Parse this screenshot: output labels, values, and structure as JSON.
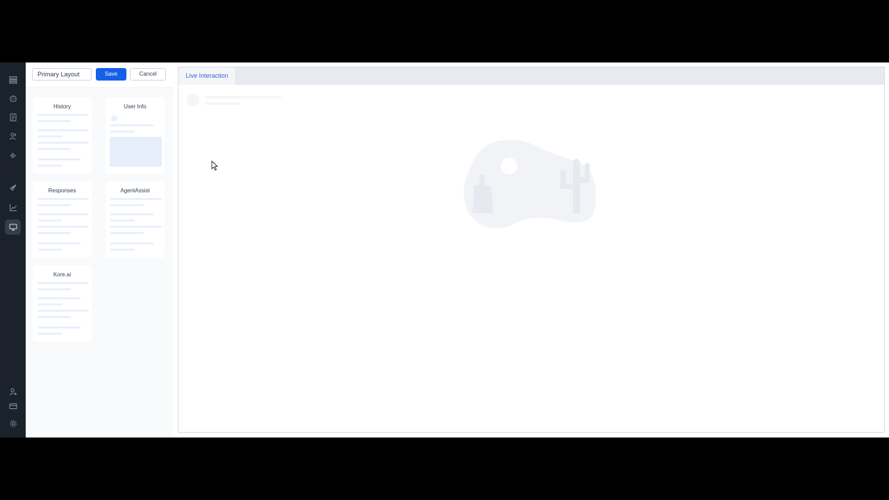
{
  "nav_rail": {
    "items": [
      {
        "icon": "layers-icon",
        "name": "nav-layers"
      },
      {
        "icon": "bot-icon",
        "name": "nav-bot"
      },
      {
        "icon": "document-icon",
        "name": "nav-documents"
      },
      {
        "icon": "users-icon",
        "name": "nav-agents"
      },
      {
        "icon": "voice-icon",
        "name": "nav-voice"
      },
      {
        "icon": "rocket-icon",
        "name": "nav-deploy"
      },
      {
        "icon": "analytics-icon",
        "name": "nav-analytics"
      },
      {
        "icon": "monitor-icon",
        "name": "nav-agent-desktop",
        "active": true
      },
      {
        "icon": "user-add-icon",
        "name": "nav-user-management"
      },
      {
        "icon": "billing-icon",
        "name": "nav-billing"
      },
      {
        "icon": "gear-icon",
        "name": "nav-settings"
      }
    ]
  },
  "toolbar": {
    "layout_name": "Primary Layout",
    "save_label": "Save",
    "cancel_label": "Cancel"
  },
  "widgets": {
    "history": "History",
    "user_info": "User Info",
    "responses": "Responses",
    "agent_assist": "AgentAssist",
    "kore_ai": "Kore.ai"
  },
  "canvas": {
    "tab_label": "Live Interaction"
  },
  "colors": {
    "rail_bg": "#1b222c",
    "primary": "#1560e8",
    "tab_text": "#3866d8"
  }
}
